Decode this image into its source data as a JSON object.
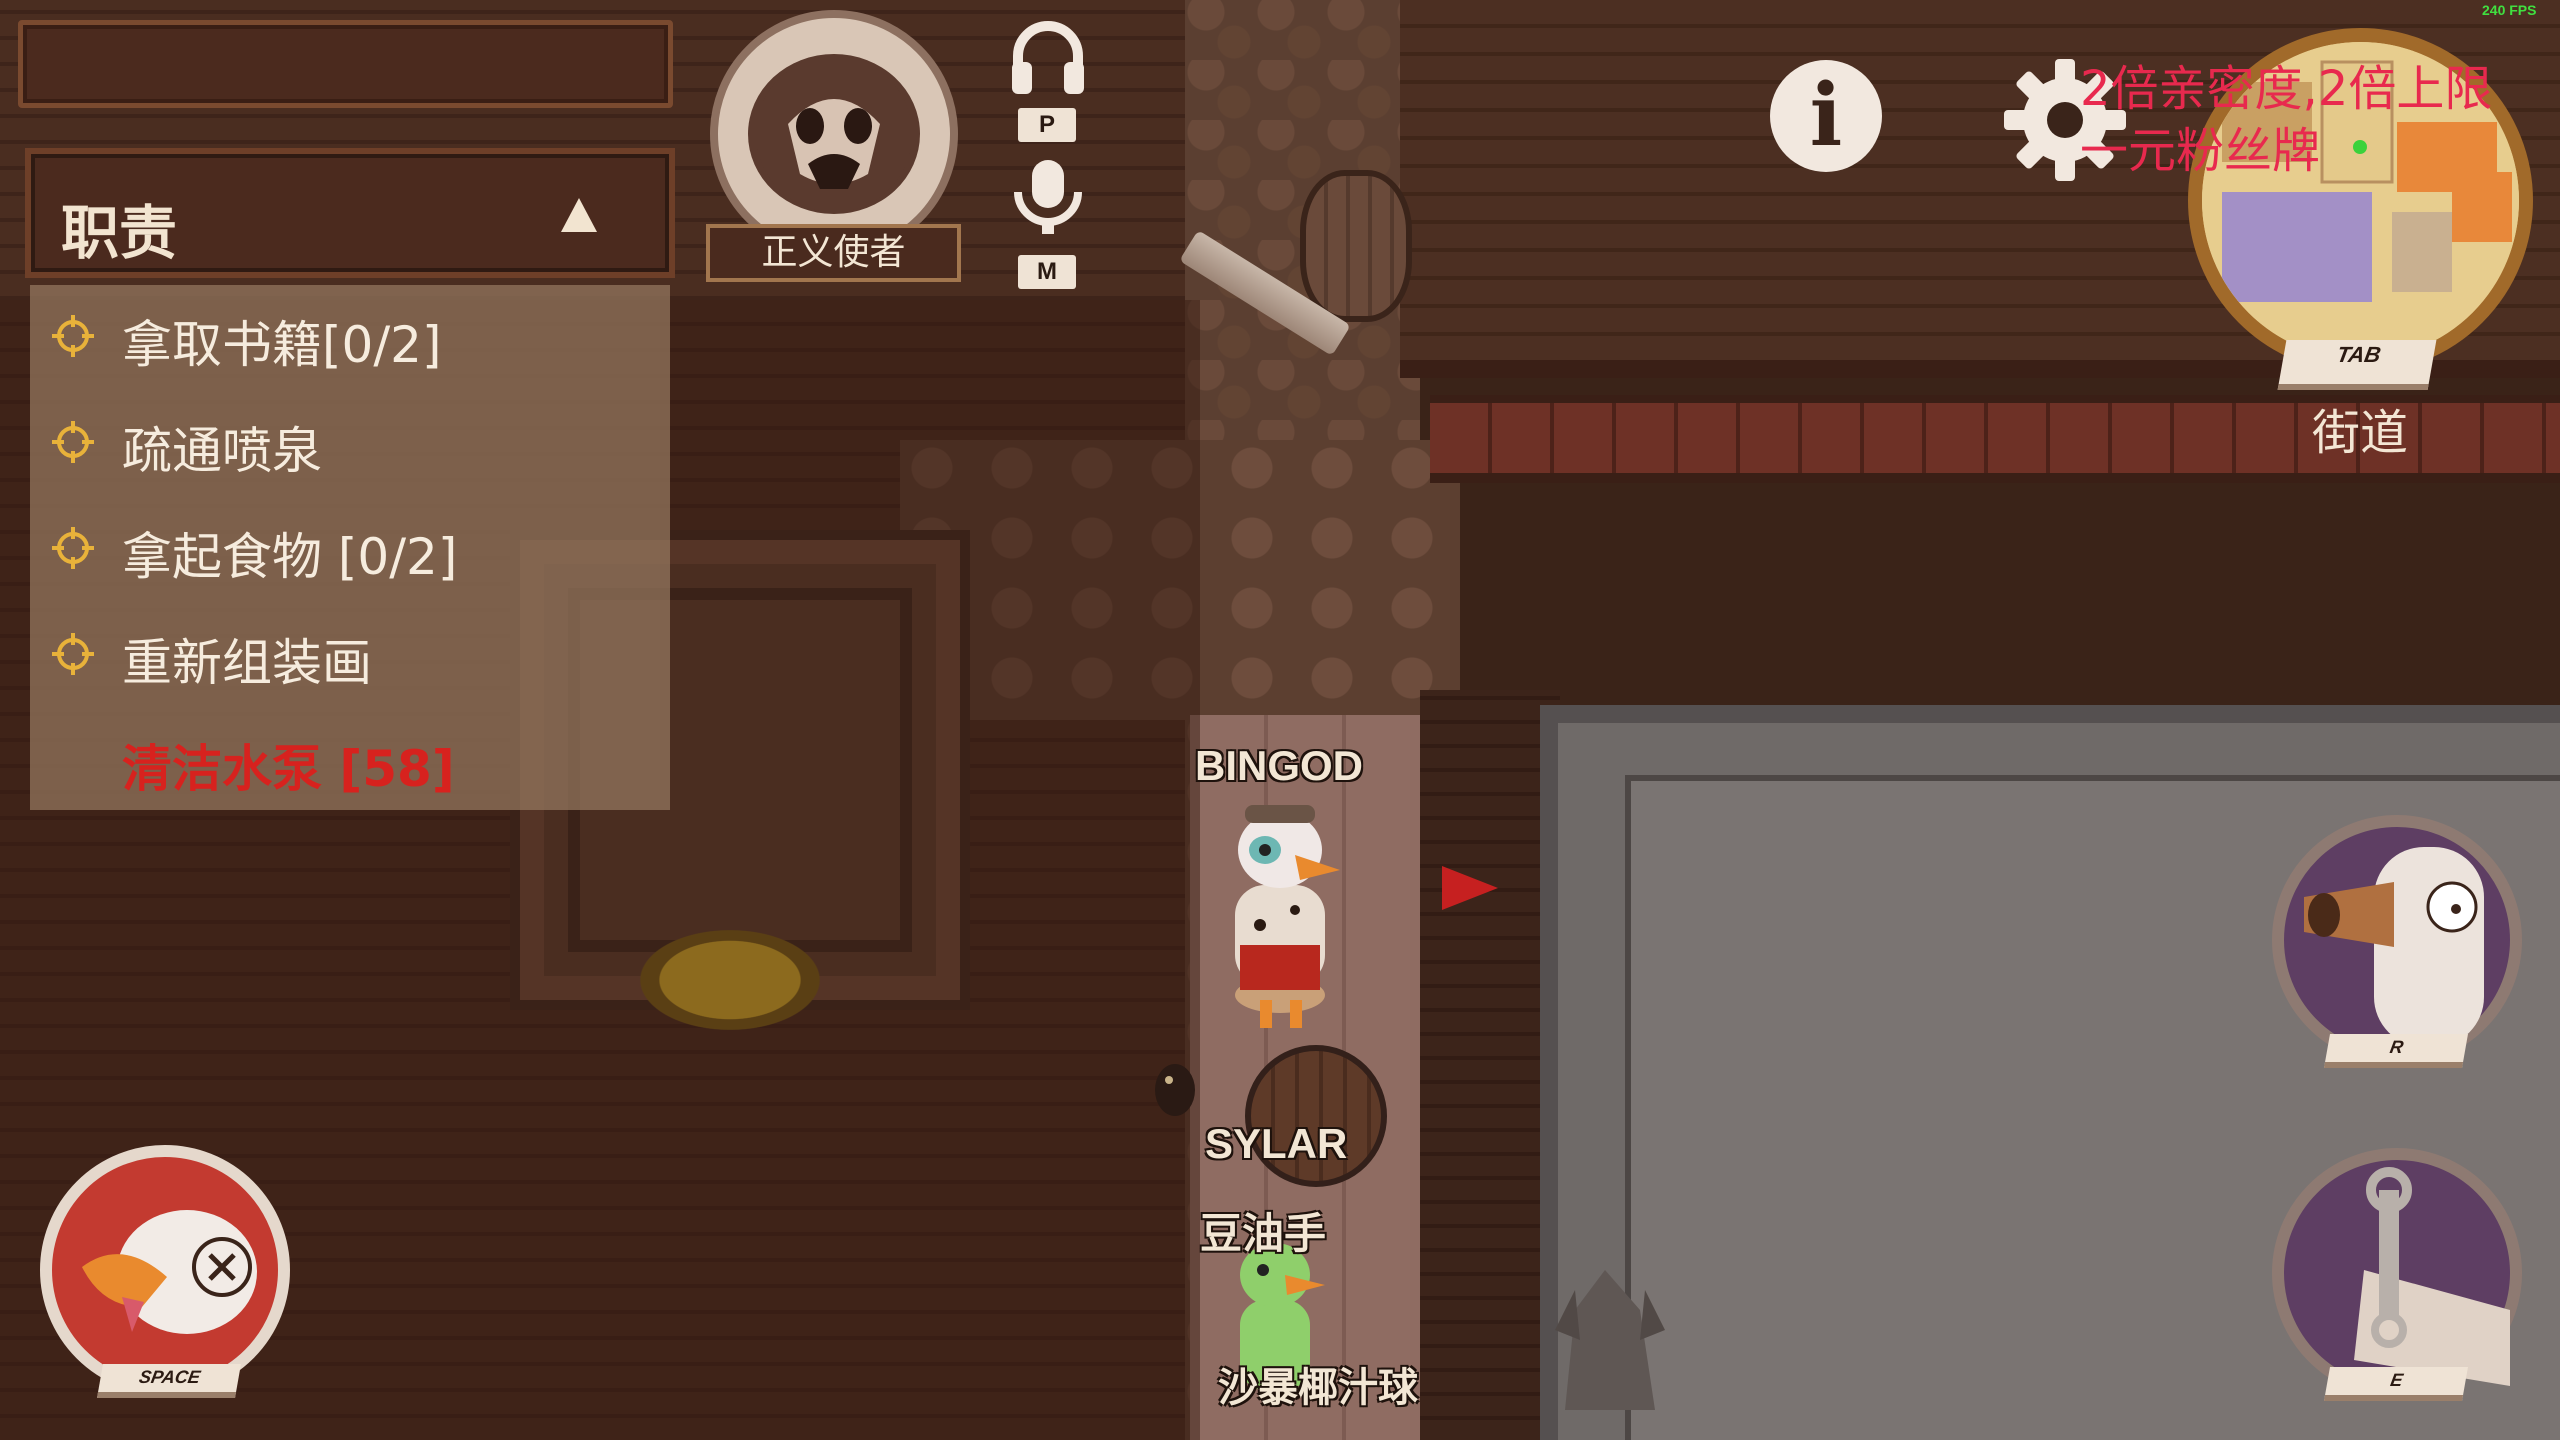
{
  "hud": {
    "fps": "240 FPS",
    "top_bar_text": "",
    "tasks": {
      "title": "职责",
      "items": [
        {
          "label": "拿取书籍[0/2]",
          "urgent": false
        },
        {
          "label": "疏通喷泉",
          "urgent": false
        },
        {
          "label": "拿起食物 [0/2]",
          "urgent": false
        },
        {
          "label": "重新组装画",
          "urgent": false
        },
        {
          "label": "清洁水泵 [58]",
          "urgent": true
        }
      ]
    },
    "role": {
      "label": "正义使者"
    },
    "voice": {
      "headset_key": "P",
      "mic_key": "M"
    },
    "minimap": {
      "key": "TAB",
      "location": "街道"
    },
    "abilities": {
      "report_key": "SPACE",
      "honk_key": "R",
      "use_key": "E"
    }
  },
  "overlay": {
    "lines": [
      "2倍亲密度,2倍上限",
      "一元粉丝牌"
    ]
  },
  "players": [
    {
      "name": "BINGOD"
    },
    {
      "name": "SYLAR"
    },
    {
      "name": "豆油手"
    },
    {
      "name": "沙暴椰汁球"
    }
  ],
  "colors": {
    "urgent_task": "#d7221e",
    "overlay_text": "#e8294e",
    "fps": "#40e040"
  }
}
